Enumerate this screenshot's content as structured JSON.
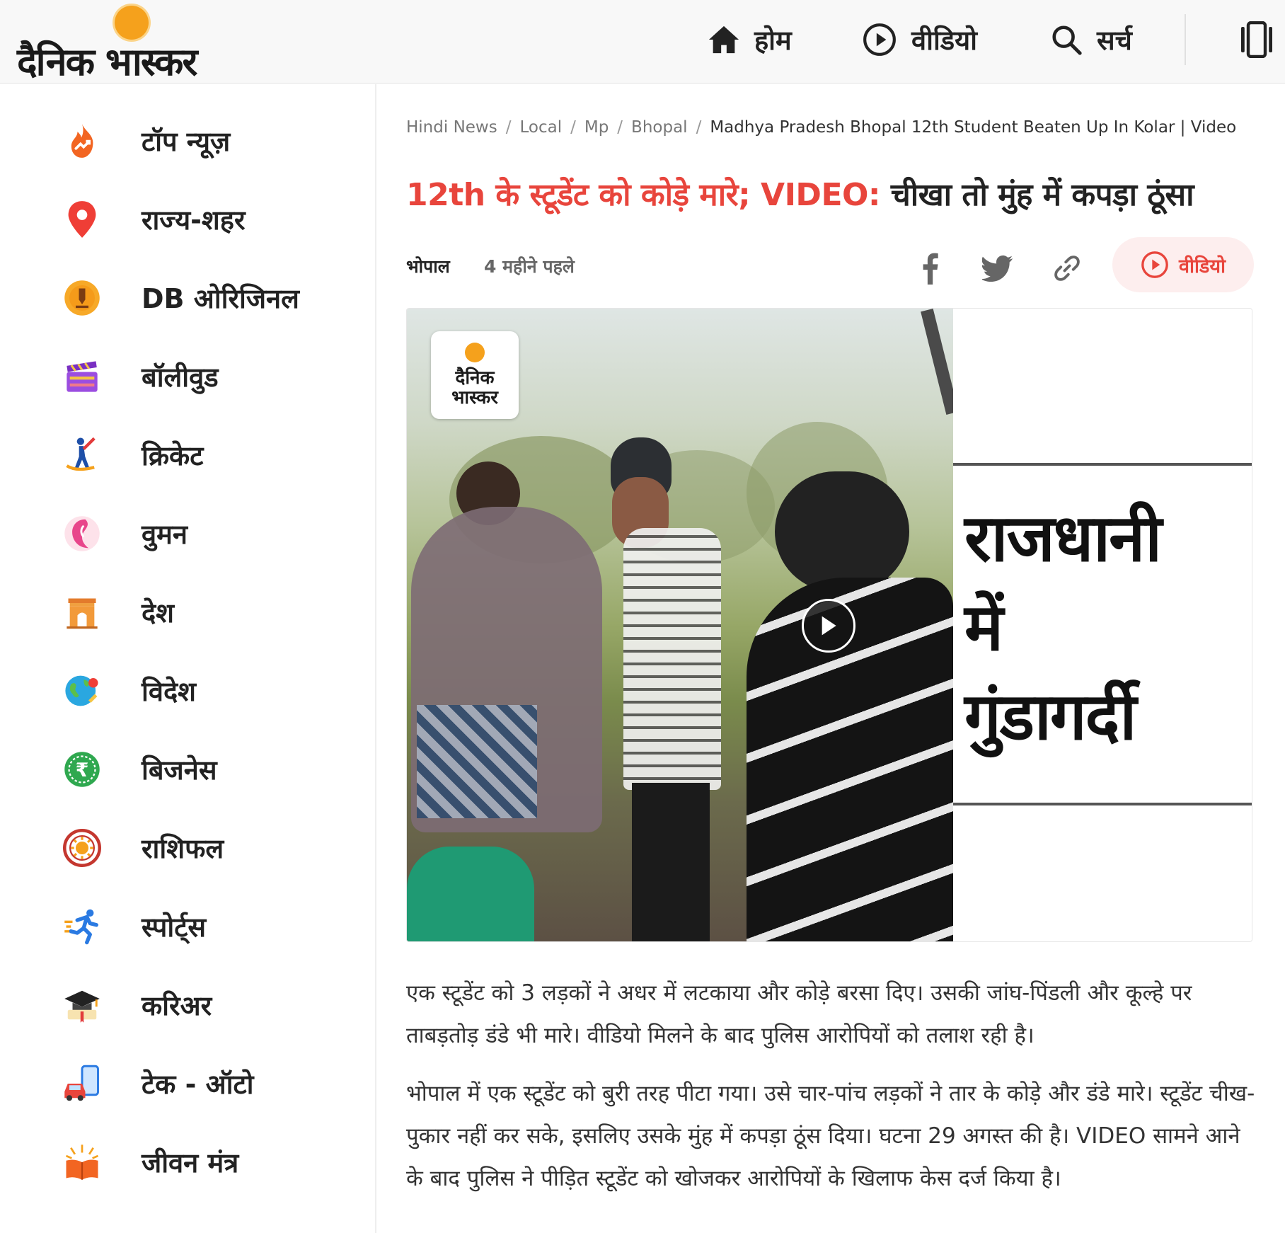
{
  "header": {
    "logo_text": "दैनिक भास्कर",
    "nav": [
      {
        "label": "होम",
        "icon": "home-icon"
      },
      {
        "label": "वीडियो",
        "icon": "play-circle-icon"
      },
      {
        "label": "सर्च",
        "icon": "search-icon"
      }
    ],
    "menu_icon": "menu-panel-icon"
  },
  "sidebar": {
    "items": [
      {
        "label": "टॉप न्यूज़",
        "icon": "fire-trending-icon"
      },
      {
        "label": "राज्य-शहर",
        "icon": "location-pin-icon"
      },
      {
        "label": "DB ओरिजिनल",
        "icon": "pen-badge-icon"
      },
      {
        "label": "बॉलीवुड",
        "icon": "clapperboard-icon"
      },
      {
        "label": "क्रिकेट",
        "icon": "cricket-player-icon"
      },
      {
        "label": "वुमन",
        "icon": "woman-profile-icon"
      },
      {
        "label": "देश",
        "icon": "india-gate-icon"
      },
      {
        "label": "विदेश",
        "icon": "globe-icon"
      },
      {
        "label": "बिजनेस",
        "icon": "rupee-coin-icon"
      },
      {
        "label": "राशिफल",
        "icon": "zodiac-wheel-icon"
      },
      {
        "label": "स्पोर्ट्स",
        "icon": "runner-icon"
      },
      {
        "label": "करिअर",
        "icon": "graduation-cap-icon"
      },
      {
        "label": "टेक - ऑटो",
        "icon": "car-phone-icon"
      },
      {
        "label": "जीवन मंत्र",
        "icon": "glowing-book-icon"
      }
    ]
  },
  "article": {
    "breadcrumb": [
      "Hindi News",
      "Local",
      "Mp",
      "Bhopal",
      "Madhya Pradesh Bhopal 12th Student Beaten Up In Kolar | Video"
    ],
    "headline_red": "12th के स्टूडेंट को कोड़े मारे; VIDEO:",
    "headline_dark": "चीखा तो मुंह में कपड़ा ठूंसा",
    "city": "भोपाल",
    "time": "4 महीने पहले",
    "share_icons": [
      "facebook-icon",
      "twitter-icon",
      "link-icon"
    ],
    "video_button_label": "वीडियो",
    "media": {
      "logo_text": "दैनिक भास्कर",
      "caption_lines": [
        "राजधानी",
        "में",
        "गुंडागर्दी"
      ]
    },
    "paragraph1": "एक स्टूडेंट को 3 लड़कों ने अधर में लटकाया और कोड़े बरसा दिए। उसकी जांघ-पिंडली और कूल्हे पर ताबड़तोड़ डंडे भी मारे। वीडियो मिलने के बाद पुलिस आरोपियों को तलाश रही है।",
    "paragraph2": "भोपाल में एक स्टूडेंट को बुरी तरह पीटा गया। उसे चार-पांच लड़कों ने तार के कोड़े और डंडे मारे। स्टूडेंट चीख-पुकार नहीं कर सके, इसलिए उसके मुंह में कपड़ा ठूंस दिया। घटना 29 अगस्त की है। VIDEO सामने आने के बाद पुलिस ने पीड़ित स्टूडेंट को खोजकर आरोपियों के खिलाफ केस दर्ज किया है।"
  },
  "colors": {
    "accent_red": "#e8453c",
    "logo_sun": "#f5a11c",
    "pill_bg": "#fdeeee"
  }
}
